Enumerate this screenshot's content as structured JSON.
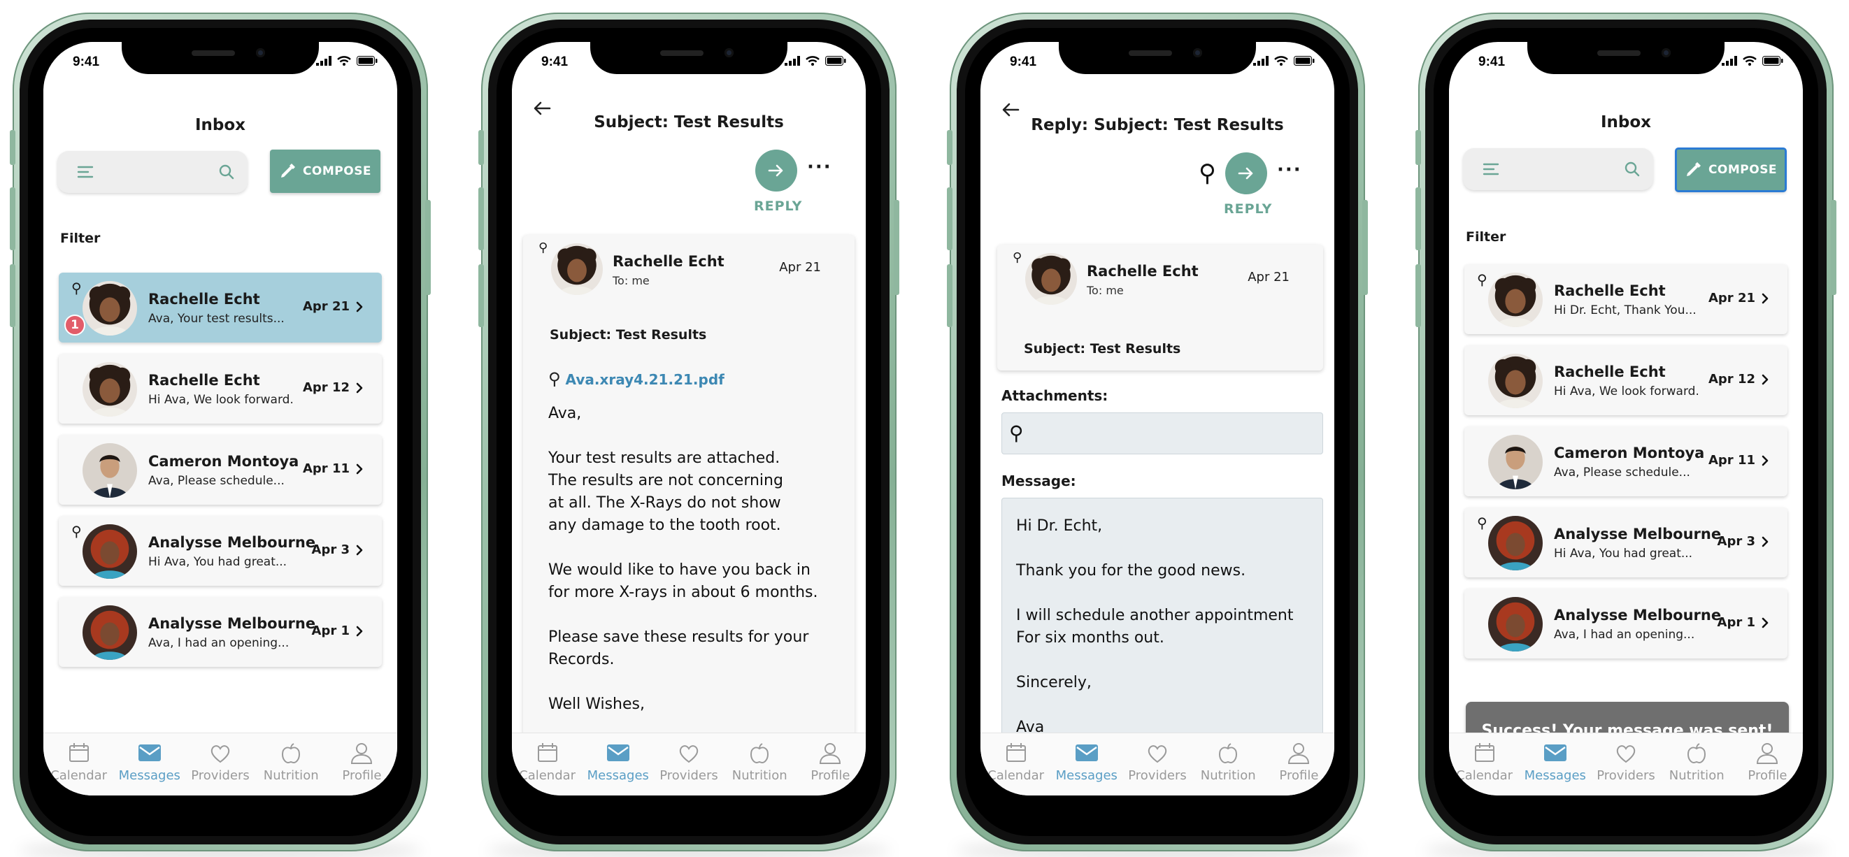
{
  "status_time": "9:41",
  "tabs": [
    {
      "label": "Calendar",
      "icon": "calendar-icon"
    },
    {
      "label": "Messages",
      "icon": "envelope-icon"
    },
    {
      "label": "Providers",
      "icon": "heart-icon"
    },
    {
      "label": "Nutrition",
      "icon": "apple-icon"
    },
    {
      "label": "Profile",
      "icon": "person-icon"
    }
  ],
  "active_tab": "Messages",
  "colors": {
    "accent": "#6aa595",
    "selected_row": "#a6cfdc",
    "tab_active": "#5a9ec5",
    "badge": "#e25d6a",
    "frame": "#9cc1aa"
  },
  "inbox": {
    "title": "Inbox",
    "compose_label": "COMPOSE",
    "filter_label": "Filter",
    "messages": [
      {
        "name": "Rachelle Echt",
        "preview": "Ava, Your test results...",
        "date": "Apr 21",
        "attachment": true,
        "badge": "1",
        "avatar": "rachelle"
      },
      {
        "name": "Rachelle Echt",
        "preview": "Hi Ava, We look forward...",
        "date": "Apr 12",
        "attachment": false,
        "avatar": "rachelle"
      },
      {
        "name": "Cameron Montoya",
        "preview": "Ava, Please schedule...",
        "date": "Apr 11",
        "attachment": false,
        "avatar": "cameron"
      },
      {
        "name": "Analysse Melbourne",
        "preview": "Hi Ava, You had great...",
        "date": "Apr 3",
        "attachment": true,
        "avatar": "analysse"
      },
      {
        "name": "Analysse Melbourne",
        "preview": "Ava, I had an opening...",
        "date": "Apr 1",
        "attachment": false,
        "avatar": "analysse"
      }
    ]
  },
  "detail": {
    "title": "Subject: Test Results",
    "reply_label": "REPLY",
    "sender": "Rachelle Echt",
    "to": "To: me",
    "date": "Apr 21",
    "subject": "Subject: Test Results",
    "attachment": "Ava.xray4.21.21.pdf",
    "body": [
      "Ava,",
      "Your test results are attached.",
      "The results are not concerning",
      "at all. The X-Rays do not show",
      "any damage to the tooth root.",
      "We would like to have you back in",
      "for more X-rays in about 6 months.",
      "Please save these results for your",
      "Records.",
      "Well Wishes,"
    ]
  },
  "reply": {
    "title": "Reply: Subject: Test Results",
    "reply_label": "REPLY",
    "sender": "Rachelle Echt",
    "to": "To: me",
    "date": "Apr 21",
    "subject": "Subject: Test Results",
    "attachments_label": "Attachments:",
    "message_label": "Message:",
    "message": [
      "Hi Dr. Echt,",
      "Thank you for the good news.",
      "I will schedule another appointment",
      "For six months out.",
      "Sincerely,",
      "Ava"
    ]
  },
  "sent": {
    "title": "Inbox",
    "compose_label": "COMPOSE",
    "filter_label": "Filter",
    "toast": "Success! Your message was sent!",
    "messages": [
      {
        "name": "Rachelle Echt",
        "preview": "Hi Dr. Echt, Thank You...",
        "date": "Apr 21",
        "attachment": true,
        "avatar": "rachelle"
      },
      {
        "name": "Rachelle Echt",
        "preview": "Hi Ava, We look forward...",
        "date": "Apr 12",
        "attachment": false,
        "avatar": "rachelle"
      },
      {
        "name": "Cameron Montoya",
        "preview": "Ava, Please schedule...",
        "date": "Apr 11",
        "attachment": false,
        "avatar": "cameron"
      },
      {
        "name": "Analysse Melbourne",
        "preview": "Hi Ava, You had great...",
        "date": "Apr 3",
        "attachment": true,
        "avatar": "analysse"
      },
      {
        "name": "Analysse Melbourne",
        "preview": "Ava, I had an opening...",
        "date": "Apr 1",
        "attachment": false,
        "avatar": "analysse"
      }
    ]
  }
}
